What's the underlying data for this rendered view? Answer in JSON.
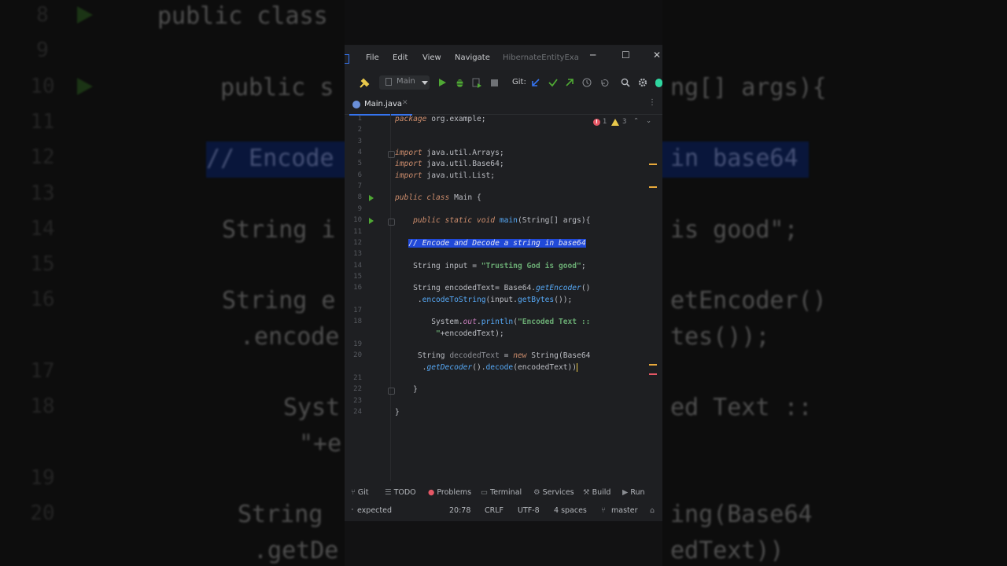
{
  "background": {
    "lines": [
      {
        "n": "8",
        "text": "public class"
      },
      {
        "n": "9",
        "text": ""
      },
      {
        "n": "10",
        "text": "public s",
        "tail": "ng[] args){"
      },
      {
        "n": "11",
        "text": ""
      },
      {
        "n": "12",
        "text": "// Encode",
        "tail": "in base64"
      },
      {
        "n": "13",
        "text": ""
      },
      {
        "n": "14",
        "text": "String i",
        "tail": "is good\";"
      },
      {
        "n": "15",
        "text": ""
      },
      {
        "n": "16",
        "text": "String e",
        "tail": "etEncoder()"
      },
      {
        "n": "",
        "text": ".encode",
        "tail": "tes());"
      },
      {
        "n": "17",
        "text": ""
      },
      {
        "n": "18",
        "text": "Syst",
        "tail": "ed Text ::"
      },
      {
        "n": "",
        "text": "\"+e",
        "tail": ""
      },
      {
        "n": "19",
        "text": ""
      },
      {
        "n": "20",
        "text": "String",
        "tail": "ing(Base64"
      },
      {
        "n": "",
        "text": ".getDe",
        "tail": "edText))"
      }
    ]
  },
  "titlebar": {
    "menus": [
      "File",
      "Edit",
      "View",
      "Navigate"
    ],
    "project": "HibernateEntityExample",
    "minimize": "─",
    "maximize": "☐",
    "close": "✕"
  },
  "toolbar": {
    "run_config": "Main",
    "vcs_label": "Git:"
  },
  "tab": {
    "label": "Main.java"
  },
  "inspections": {
    "errors": "1",
    "warnings": "3"
  },
  "code": [
    {
      "n": "1",
      "html": "<span class=\"kw\">package</span> org.example;"
    },
    {
      "n": "2",
      "html": ""
    },
    {
      "n": "3",
      "html": ""
    },
    {
      "n": "4",
      "html": "<span class=\"kw\">import</span> java.util.Arrays;"
    },
    {
      "n": "5",
      "html": "<span class=\"kw\">import</span> java.util.Base64;"
    },
    {
      "n": "6",
      "html": "<span class=\"kw\">import</span> java.util.List;"
    },
    {
      "n": "7",
      "html": ""
    },
    {
      "n": "8",
      "html": "<span class=\"kw\">public class</span> Main {"
    },
    {
      "n": "9",
      "html": ""
    },
    {
      "n": "10",
      "html": "    <span class=\"kw\">public static void</span> <span class=\"fn\">main</span>(String[] args){"
    },
    {
      "n": "11",
      "html": ""
    },
    {
      "n": "12",
      "html": "   <span class=\"sel cm\">// Encode and Decode a string in base64</span>"
    },
    {
      "n": "13",
      "html": ""
    },
    {
      "n": "14",
      "html": "    String input = <span class=\"str\">\"Trusting God is good\"</span>;"
    },
    {
      "n": "15",
      "html": ""
    },
    {
      "n": "16",
      "html": "    String encodedText= Base64.<span class=\"fn\" style=\"font-style:italic\">getEncoder</span>()"
    },
    {
      "n": "",
      "html": "     .<span class=\"fn\">encodeToString</span>(input.<span class=\"fn\">getBytes</span>());"
    },
    {
      "n": "17",
      "html": ""
    },
    {
      "n": "18",
      "html": "        System.<span class=\"fld\">out</span>.<span class=\"fn\">println</span>(<span class=\"str\">\"Encoded Text ::</span>"
    },
    {
      "n": "",
      "html": "         <span class=\"str\">\"</span>+encodedText);"
    },
    {
      "n": "19",
      "html": ""
    },
    {
      "n": "20",
      "html": "     String <span style=\"color:#8d8f95\">decodedText</span> = <span class=\"kw\">new</span> String(Base64"
    },
    {
      "n": "",
      "html": "      .<span class=\"fn\" style=\"font-style:italic\">getDecoder</span>().<span class=\"fn\">decode</span>(encodedText))<span style=\"border-left:1px solid #e8c84b\">&#8203;</span>"
    },
    {
      "n": "21",
      "html": ""
    },
    {
      "n": "22",
      "html": "    }"
    },
    {
      "n": "23",
      "html": ""
    },
    {
      "n": "24",
      "html": "}"
    }
  ],
  "bottom_tools": [
    "Git",
    "TODO",
    "Problems",
    "Terminal",
    "Services",
    "Build",
    "Run"
  ],
  "status": {
    "message": "expected",
    "position": "20:78",
    "line_sep": "CRLF",
    "encoding": "UTF-8",
    "indent": "4 spaces",
    "branch": "master"
  },
  "colors": {
    "accent": "#3574f0",
    "selection": "#2049d8",
    "run_green": "#4fa834"
  }
}
